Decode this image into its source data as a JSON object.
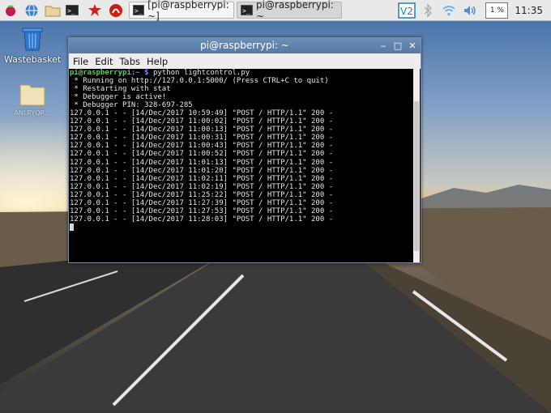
{
  "taskbar": {
    "launchers": [
      "raspberry-menu",
      "web-browser",
      "file-manager",
      "terminal",
      "mathematica",
      "wolfram"
    ],
    "tasks": [
      {
        "label": "[pi@raspberrypi: ~]",
        "active": false
      },
      {
        "label": "pi@raspberrypi: ~",
        "active": true
      }
    ],
    "tray": {
      "cpu": "1 %",
      "clock": "11:35"
    }
  },
  "desktop": {
    "icons": [
      {
        "label": "Wastebasket"
      },
      {
        "label": "ANLRYQR..."
      }
    ]
  },
  "window": {
    "title": "pi@raspberrypi: ~",
    "menu": [
      "File",
      "Edit",
      "Tabs",
      "Help"
    ],
    "prompt_user": "pi@raspberrypi",
    "prompt_path": ":~ $",
    "command": " python lightcontrol.py",
    "lines": [
      " * Running on http://127.0.0.1:5000/ (Press CTRL+C to quit)",
      " * Restarting with stat",
      " * Debugger is active!",
      " * Debugger PIN: 328-697-285",
      "127.0.0.1 - - [14/Dec/2017 10:59:49] \"POST / HTTP/1.1\" 200 -",
      "127.0.0.1 - - [14/Dec/2017 11:00:02] \"POST / HTTP/1.1\" 200 -",
      "127.0.0.1 - - [14/Dec/2017 11:00:13] \"POST / HTTP/1.1\" 200 -",
      "127.0.0.1 - - [14/Dec/2017 11:00:31] \"POST / HTTP/1.1\" 200 -",
      "127.0.0.1 - - [14/Dec/2017 11:00:43] \"POST / HTTP/1.1\" 200 -",
      "127.0.0.1 - - [14/Dec/2017 11:00:52] \"POST / HTTP/1.1\" 200 -",
      "127.0.0.1 - - [14/Dec/2017 11:01:13] \"POST / HTTP/1.1\" 200 -",
      "127.0.0.1 - - [14/Dec/2017 11:01:20] \"POST / HTTP/1.1\" 200 -",
      "127.0.0.1 - - [14/Dec/2017 11:02:11] \"POST / HTTP/1.1\" 200 -",
      "127.0.0.1 - - [14/Dec/2017 11:02:19] \"POST / HTTP/1.1\" 200 -",
      "127.0.0.1 - - [14/Dec/2017 11:25:22] \"POST / HTTP/1.1\" 200 -",
      "127.0.0.1 - - [14/Dec/2017 11:27:39] \"POST / HTTP/1.1\" 200 -",
      "127.0.0.1 - - [14/Dec/2017 11:27:53] \"POST / HTTP/1.1\" 200 -",
      "127.0.0.1 - - [14/Dec/2017 11:28:03] \"POST / HTTP/1.1\" 200 -"
    ]
  },
  "colors": {
    "titlebar": "#5f84b0",
    "prompt_user": "#4ed64e",
    "prompt_path": "#6b8cff"
  }
}
